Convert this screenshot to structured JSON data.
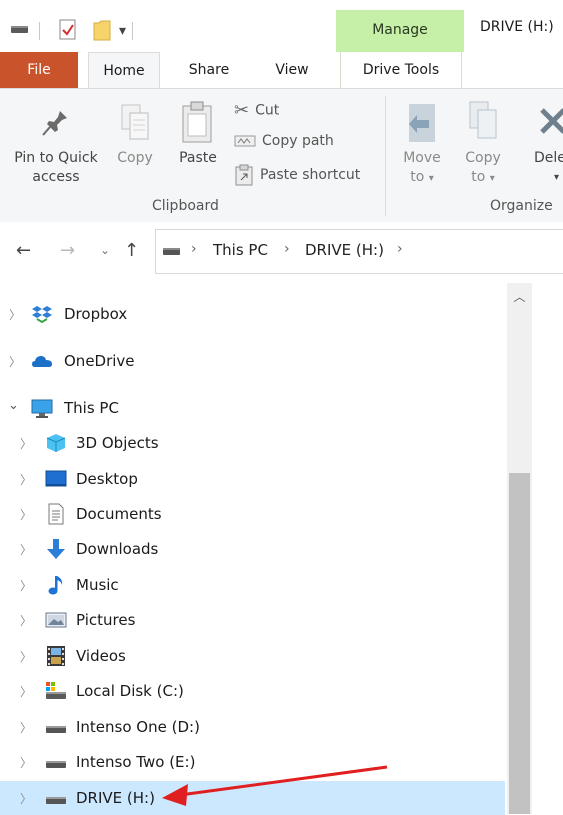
{
  "window": {
    "title": "DRIVE (H:)"
  },
  "titlebar": {
    "contextual_group": "Manage",
    "quick_access_icons": [
      "drive-icon",
      "properties-icon",
      "new-folder-icon",
      "customize-dropdown-icon"
    ]
  },
  "tabs": [
    {
      "label": "File"
    },
    {
      "label": "Home"
    },
    {
      "label": "Share"
    },
    {
      "label": "View"
    },
    {
      "label": "Drive Tools"
    }
  ],
  "ribbon": {
    "pin_label": "Pin to Quick access",
    "copy_label": "Copy",
    "paste_label": "Paste",
    "cut_label": "Cut",
    "copy_path_label": "Copy path",
    "paste_shortcut_label": "Paste shortcut",
    "clipboard_group": "Clipboard",
    "move_to_label": "Move to",
    "copy_to_label": "Copy to",
    "delete_label": "Dele",
    "organize_group": "Organize",
    "dropdown_marker": "▾"
  },
  "address": {
    "crumbs": [
      "This PC",
      "DRIVE (H:)"
    ],
    "separator": "›"
  },
  "nav": {
    "items": [
      {
        "label": "Dropbox",
        "icon": "dropbox-icon",
        "expanded": false
      },
      {
        "label": "OneDrive",
        "icon": "onedrive-icon",
        "expanded": false
      },
      {
        "label": "This PC",
        "icon": "this-pc-icon",
        "expanded": true
      },
      {
        "label": "3D Objects",
        "icon": "3d-objects-icon",
        "expanded": false
      },
      {
        "label": "Desktop",
        "icon": "desktop-folder-icon",
        "expanded": false
      },
      {
        "label": "Documents",
        "icon": "documents-folder-icon",
        "expanded": false
      },
      {
        "label": "Downloads",
        "icon": "downloads-folder-icon",
        "expanded": false
      },
      {
        "label": "Music",
        "icon": "music-folder-icon",
        "expanded": false
      },
      {
        "label": "Pictures",
        "icon": "pictures-folder-icon",
        "expanded": false
      },
      {
        "label": "Videos",
        "icon": "videos-folder-icon",
        "expanded": false
      },
      {
        "label": "Local Disk (C:)",
        "icon": "local-disk-icon",
        "expanded": false
      },
      {
        "label": "Intenso One (D:)",
        "icon": "drive-icon",
        "expanded": false
      },
      {
        "label": "Intenso Two (E:)",
        "icon": "drive-icon",
        "expanded": false
      },
      {
        "label": "DRIVE (H:)",
        "icon": "drive-icon",
        "expanded": false,
        "selected": true
      }
    ]
  },
  "colors": {
    "file_tab": "#c9532a",
    "manage_tab": "#c6efa8",
    "selection": "#cce8ff",
    "annotation_arrow": "#e02020"
  }
}
